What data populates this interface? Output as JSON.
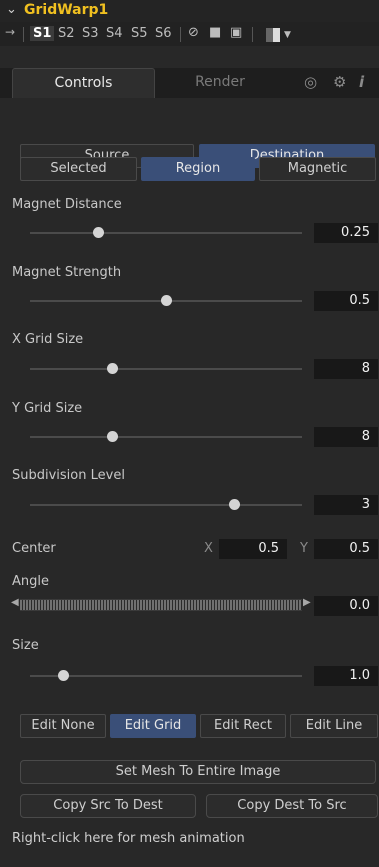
{
  "header": {
    "title": "GridWarp1",
    "collapse_icon": "chevron-down-icon",
    "slots": [
      "S1",
      "S2",
      "S3",
      "S4",
      "S5",
      "S6"
    ]
  },
  "tabs": {
    "controls": "Controls",
    "render": "Render"
  },
  "mode": {
    "source": "Source",
    "destination": "Destination"
  },
  "selection": {
    "selected": "Selected",
    "region": "Region",
    "magnetic": "Magnetic"
  },
  "sliders": {
    "magnet_distance": {
      "label": "Magnet Distance",
      "value": "0.25",
      "fraction": 0.25
    },
    "magnet_strength": {
      "label": "Magnet Strength",
      "value": "0.5",
      "fraction": 0.5
    },
    "x_grid_size": {
      "label": "X Grid Size",
      "value": "8",
      "fraction": 0.3
    },
    "y_grid_size": {
      "label": "Y Grid Size",
      "value": "8",
      "fraction": 0.3
    },
    "subdivision_level": {
      "label": "Subdivision Level",
      "value": "3",
      "fraction": 0.75
    },
    "size": {
      "label": "Size",
      "value": "1.0",
      "fraction": 0.12
    }
  },
  "center": {
    "label": "Center",
    "x_label": "X",
    "x": "0.5",
    "y_label": "Y",
    "y": "0.5"
  },
  "angle": {
    "label": "Angle",
    "value": "0.0"
  },
  "edit": {
    "none": "Edit None",
    "grid": "Edit Grid",
    "rect": "Edit Rect",
    "line": "Edit Line"
  },
  "actions": {
    "set_mesh": "Set Mesh To Entire Image",
    "copy_src": "Copy Src To Dest",
    "copy_dest": "Copy Dest To Src"
  },
  "hint": "Right-click here for mesh animation",
  "colors": {
    "accent_title": "#f0c020",
    "selected_button": "#3a4f78",
    "background": "#282828"
  }
}
